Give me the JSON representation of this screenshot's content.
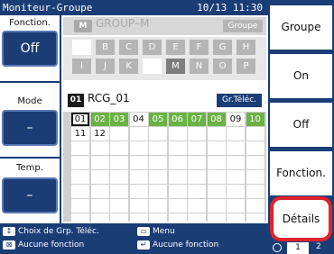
{
  "header": {
    "title": "Moniteur-Groupe",
    "datetime": "10/13 11:30"
  },
  "left": {
    "fonction_label": "Fonction.",
    "fonction_value": "Off",
    "mode_label": "Mode",
    "mode_value": "–",
    "temp_label": "Temp.",
    "temp_value": "–"
  },
  "group": {
    "badge": "M",
    "name": "GROUP–M",
    "tag": "Groupe",
    "letters_row1": [
      "",
      "B",
      "C",
      "D",
      "E",
      "F",
      "G",
      "H"
    ],
    "letters_row2": [
      "I",
      "J",
      "K",
      "",
      "M",
      "N",
      "O",
      "P"
    ]
  },
  "subgroup": {
    "badge": "01",
    "name": "RCG_01",
    "tag": "Gr.Téléc."
  },
  "units": [
    "01",
    "02",
    "03",
    "04",
    "05",
    "06",
    "07",
    "08",
    "09",
    "10",
    "11",
    "12"
  ],
  "right_menu": [
    "Groupe",
    "On",
    "Off",
    "Fonction.",
    "Détails"
  ],
  "footer": {
    "choose": "Choix de Grp. Téléc.",
    "menu": "Menu",
    "nofunc1": "Aucune fonction",
    "nofunc2": "Aucune fonction",
    "page": [
      "1",
      "2"
    ]
  },
  "colors": {
    "accent": "#1b3d75",
    "highlight": "#e0232e",
    "unit_active": "#6bb246"
  }
}
